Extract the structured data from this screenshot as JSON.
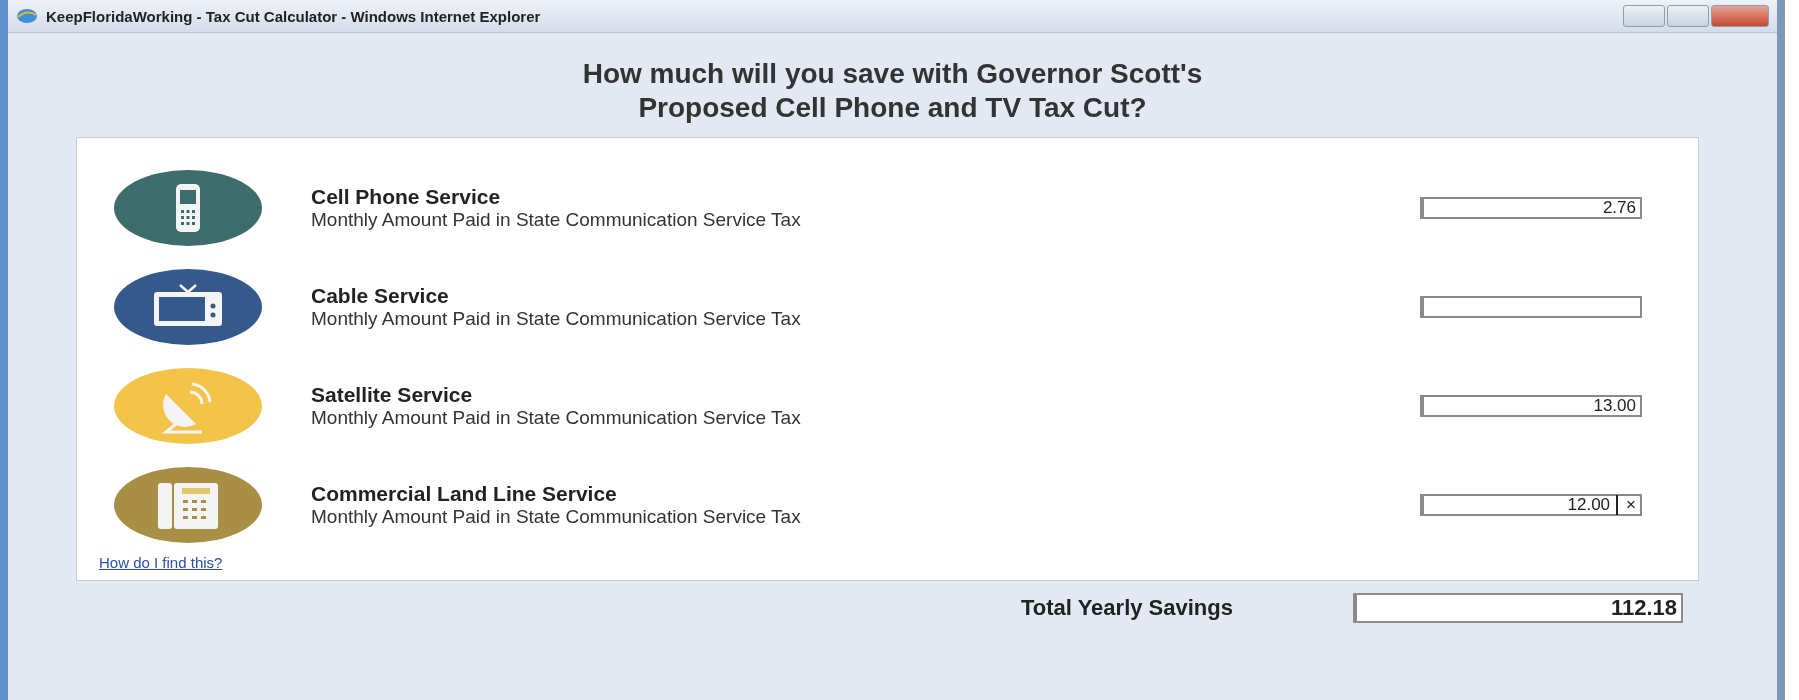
{
  "window": {
    "title": "KeepFloridaWorking - Tax Cut Calculator - Windows Internet Explorer"
  },
  "heading": [
    "How much will you save with Governor Scott's",
    "Proposed Cell Phone and TV Tax Cut?"
  ],
  "services": [
    {
      "kind": "phone",
      "color": "#3e6b6c",
      "name": "Cell Phone Service",
      "description": "Monthly Amount Paid in State Communication Service Tax",
      "value": "2.76"
    },
    {
      "kind": "tv",
      "color": "#34598a",
      "name": "Cable Service",
      "description": "Monthly Amount Paid in State Communication Service Tax"
    },
    {
      "kind": "satellite",
      "color": "#f3c34a",
      "name": "Satellite Service",
      "description": "Monthly Amount Paid in State Communication Service Tax",
      "value": "13.00"
    },
    {
      "kind": "landline",
      "color": "#a98f45",
      "name": "Commercial Land Line Service",
      "description": "Monthly Amount Paid in State Communication Service Tax",
      "value": "12.00",
      "clear_label": "×"
    }
  ],
  "help_link": "How do I find this?",
  "total": {
    "label": "Total Yearly Savings",
    "value": "112.18"
  }
}
